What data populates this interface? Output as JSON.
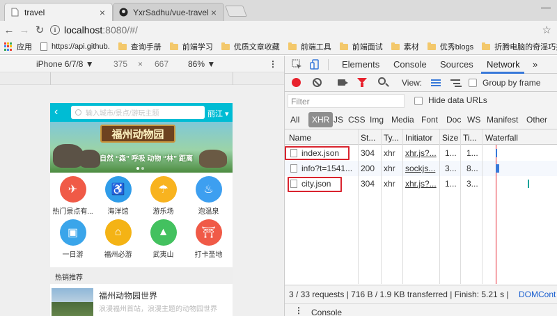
{
  "browser": {
    "tabs": [
      {
        "title": "travel"
      },
      {
        "title": "YxrSadhu/vue-travel at"
      }
    ],
    "url_host": "localhost",
    "url_path": ":8080/#/",
    "bookmarks": [
      "应用",
      "https://api.github.",
      "查询手册",
      "前端学习",
      "优质文章收藏",
      "前端工具",
      "前端面试",
      "素材",
      "优秀blogs",
      "折腾电脑的奇淫巧技"
    ]
  },
  "device_toolbar": {
    "device": "iPhone 6/7/8 ▼",
    "width": "375",
    "times": "×",
    "height": "667",
    "zoom": "86% ▼"
  },
  "app": {
    "back": "‹",
    "search_placeholder": "输入城市/景点/游玩主题",
    "city": "丽江 ▾",
    "banner_title": "福州动物园",
    "banner_slogan": "自然 “森” 呼吸  动物 “林” 距离",
    "icons": [
      {
        "label": "热门景点有...",
        "color": "#f05a47",
        "glyph": "✈"
      },
      {
        "label": "海洋馆",
        "color": "#2f9ce9",
        "glyph": "♿"
      },
      {
        "label": "游乐场",
        "color": "#f8b31f",
        "glyph": "☂"
      },
      {
        "label": "泡温泉",
        "color": "#3d9ff0",
        "glyph": "♨"
      },
      {
        "label": "一日游",
        "color": "#3aa5ea",
        "glyph": "▣"
      },
      {
        "label": "福州必游",
        "color": "#f4b315",
        "glyph": "⌂"
      },
      {
        "label": "武夷山",
        "color": "#43c15f",
        "glyph": "▲"
      },
      {
        "label": "打卡圣地",
        "color": "#f05a47",
        "glyph": "⛩"
      }
    ],
    "section_title": "热销推荐",
    "item_title": "福州动物园世界",
    "item_desc": "浪漫福州首站，浪漫主题的动物园世界"
  },
  "devtools": {
    "tabs": [
      "Elements",
      "Console",
      "Sources",
      "Network"
    ],
    "more": "»",
    "view_label": "View:",
    "group_by_frame": "Group by frame",
    "filter_placeholder": "Filter",
    "hide_data_urls": "Hide data URLs",
    "type_filters": [
      "All",
      "XHR",
      "JS",
      "CSS",
      "Img",
      "Media",
      "Font",
      "Doc",
      "WS",
      "Manifest",
      "Other"
    ],
    "columns": [
      "Name",
      "St...",
      "Ty...",
      "Initiator",
      "Size",
      "Ti...",
      "Waterfall"
    ],
    "rows": [
      {
        "name": "index.json",
        "status": "304",
        "type": "xhr",
        "initiator": "xhr.js?...",
        "size": "1...",
        "time": "1..."
      },
      {
        "name": "info?t=1541...",
        "status": "200",
        "type": "xhr",
        "initiator": "sockjs...",
        "size": "3...",
        "time": "8..."
      },
      {
        "name": "city.json",
        "status": "304",
        "type": "xhr",
        "initiator": "xhr.js?...",
        "size": "1...",
        "time": "3..."
      }
    ],
    "status_bar": "3 / 33 requests  |  716 B / 1.9 KB transferred  |  Finish: 5.21 s  |",
    "dom_content": "DOMCont",
    "drawer_label": "Console",
    "colors": {
      "record": "#e8222d",
      "accent": "#3879d9",
      "annotation": "#d9232e"
    }
  }
}
